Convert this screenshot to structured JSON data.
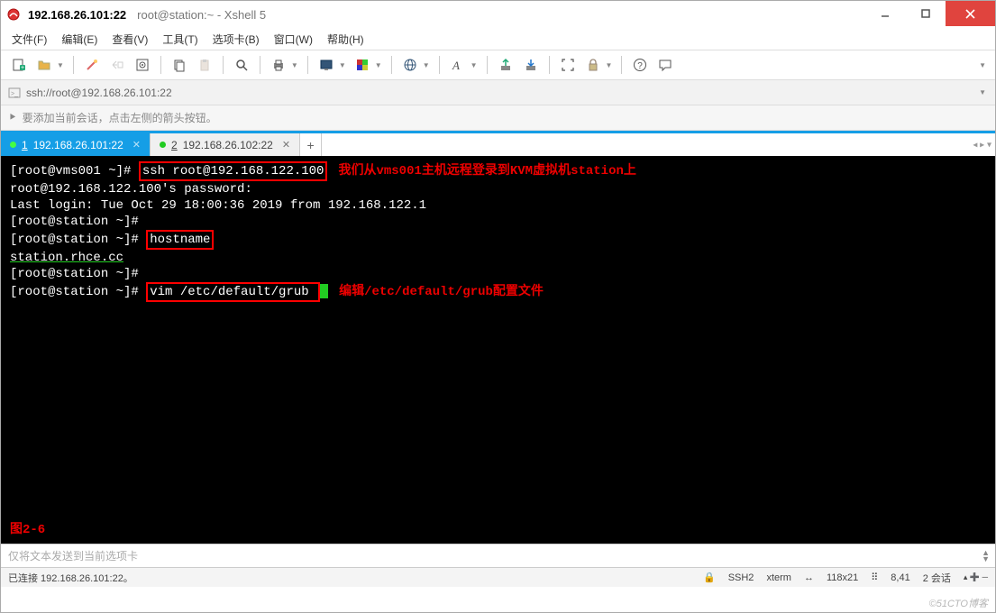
{
  "title": {
    "address": "192.168.26.101:22",
    "suffix": "root@station:~ - Xshell 5"
  },
  "menus": [
    "文件(F)",
    "编辑(E)",
    "查看(V)",
    "工具(T)",
    "选项卡(B)",
    "窗口(W)",
    "帮助(H)"
  ],
  "toolbar_icons": [
    "new-session-icon",
    "open-icon",
    "sep",
    "reconnect-icon",
    "disconnect-icon",
    "properties-icon",
    "sep",
    "copy-icon",
    "paste-icon",
    "sep",
    "find-icon",
    "sep",
    "print-icon",
    "drop",
    "sep",
    "font-icon",
    "drop",
    "color-icon",
    "drop",
    "sep",
    "globe-icon",
    "drop",
    "sep",
    "fontstyle-icon",
    "drop",
    "sep",
    "upload-icon",
    "download-icon",
    "sep",
    "fullscreen-icon",
    "lock-icon",
    "drop",
    "sep",
    "help-icon",
    "chat-icon"
  ],
  "addressbar": {
    "url": "ssh://root@192.168.26.101:22"
  },
  "infobar_text": "要添加当前会话，点击左侧的箭头按钮。",
  "tabs": [
    {
      "num": "1",
      "label": "192.168.26.101:22",
      "active": true
    },
    {
      "num": "2",
      "label": "192.168.26.102:22",
      "active": false
    }
  ],
  "terminal": {
    "l1_prompt": "[root@vms001 ~]# ",
    "l1_cmd": "ssh root@192.168.122.100",
    "l1_ann": "我们从vms001主机远程登录到KVM虚拟机station上",
    "l2": "root@192.168.122.100's password:",
    "l3": "Last login: Tue Oct 29 18:00:36 2019 from 192.168.122.1",
    "l4": "[root@station ~]#",
    "l5_prompt": "[root@station ~]# ",
    "l5_cmd": "hostname",
    "l6": "station.rhce.cc",
    "l7": "[root@station ~]#",
    "l8_prompt": "[root@station ~]# ",
    "l8_cmd": "vim /etc/default/grub ",
    "l8_ann": "编辑/etc/default/grub配置文件",
    "fig": "图2-6"
  },
  "sendbar_placeholder": "仅将文本发送到当前选项卡",
  "status": {
    "left": "已连接 192.168.26.101:22。",
    "proto": "SSH2",
    "term": "xterm",
    "size": "118x21",
    "pos": "8,41",
    "sessions": "2 会话"
  },
  "watermark": "©51CTO博客"
}
